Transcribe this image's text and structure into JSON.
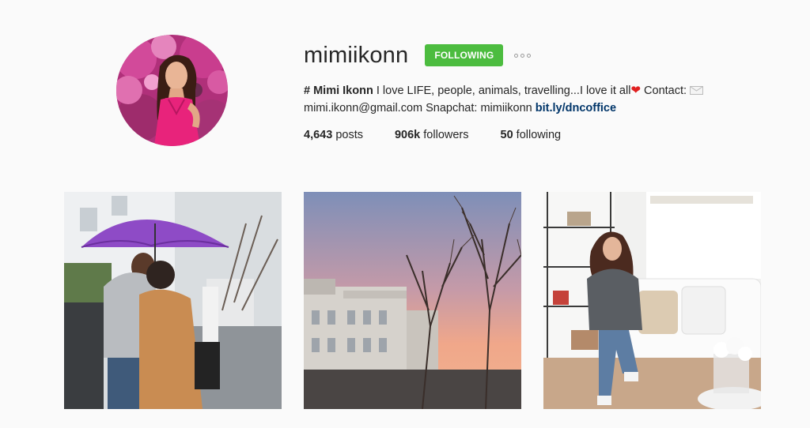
{
  "profile": {
    "username": "mimiikonn",
    "follow_label": "FOLLOWING",
    "more_icon": "more-dots-icon",
    "bio": {
      "prefix": "# Mimi Ikonn",
      "text1": " I love LIFE, people, animals, travelling...I love it all",
      "heart": "❤",
      "text2": " Contact: ",
      "mail_icon": "envelope-icon",
      "text3": "mimi.ikonn@gmail.com Snapchat: mimiikonn ",
      "link": "bit.ly/dncoffice"
    },
    "stats": {
      "posts_count": "4,643",
      "posts_label": " posts",
      "followers_count": "906k",
      "followers_label": " followers",
      "following_count": "50",
      "following_label": " following"
    }
  },
  "colors": {
    "following_button": "#4cbc3f",
    "link": "#003569",
    "background": "#fafafa"
  },
  "posts": [
    {
      "alt": "couple-under-purple-umbrella-photo"
    },
    {
      "alt": "sunset-over-london-terrace-photo"
    },
    {
      "alt": "woman-in-white-living-room-photo"
    }
  ]
}
